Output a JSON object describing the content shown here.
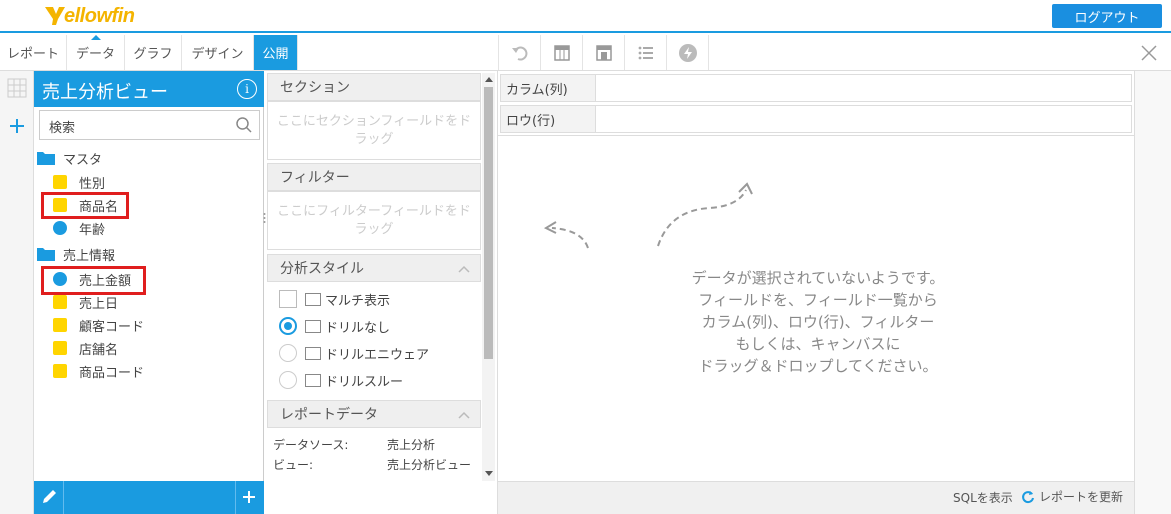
{
  "app": {
    "logo_text": "ellowfin",
    "logout_label": "ログアウト"
  },
  "tabs": [
    {
      "label": "レポート"
    },
    {
      "label": "データ"
    },
    {
      "label": "グラフ"
    },
    {
      "label": "デザイン"
    },
    {
      "label": "公開"
    }
  ],
  "toolbar": {
    "icons": [
      "undo-icon",
      "table-icon",
      "print-icon",
      "list-icon",
      "bolt-icon"
    ],
    "close_icon": "close-icon"
  },
  "data_panel": {
    "title": "売上分析ビュー",
    "search_placeholder": "検索",
    "folders": [
      {
        "name": "マスタ",
        "fields": [
          {
            "label": "性別",
            "type": "dimension"
          },
          {
            "label": "商品名",
            "type": "dimension",
            "highlighted": true
          },
          {
            "label": "年齢",
            "type": "metric"
          }
        ]
      },
      {
        "name": "売上情報",
        "fields": [
          {
            "label": "売上金額",
            "type": "metric",
            "highlighted": true
          },
          {
            "label": "売上日",
            "type": "date"
          },
          {
            "label": "顧客コード",
            "type": "dimension"
          },
          {
            "label": "店舗名",
            "type": "dimension"
          },
          {
            "label": "商品コード",
            "type": "dimension"
          }
        ]
      }
    ]
  },
  "middle": {
    "section_title": "セクション",
    "section_drop": [
      "ここにセクションフィールドをド",
      "ラッグ"
    ],
    "filter_title": "フィルター",
    "filter_drop": [
      "ここにフィルターフィールドをド",
      "ラッグ"
    ],
    "analysis_title": "分析スタイル",
    "multi_label": "マルチ表示",
    "options": [
      {
        "label": "ドリルなし",
        "selected": true
      },
      {
        "label": "ドリルエニウェア",
        "selected": false
      },
      {
        "label": "ドリルスルー",
        "selected": false
      }
    ],
    "report_data_title": "レポートデータ",
    "report_data": [
      {
        "key": "データソース:",
        "value": "売上分析"
      },
      {
        "key": "ビュー:",
        "value": "売上分析ビュー"
      }
    ]
  },
  "canvas": {
    "column_label": "カラム(列)",
    "row_label": "ロウ(行)",
    "empty_lines": [
      "データが選択されていないようです。",
      "フィールドを、フィールド一覧から",
      "カラム(列)、ロウ(行)、フィルター",
      "もしくは、キャンバスに",
      "ドラッグ＆ドロップしてください。"
    ]
  },
  "status": {
    "sql_label": "SQLを表示",
    "refresh_label": "レポートを更新"
  },
  "colors": {
    "accent": "#1a9be0",
    "dimension": "#ffd500",
    "highlight": "#e01e1e"
  }
}
